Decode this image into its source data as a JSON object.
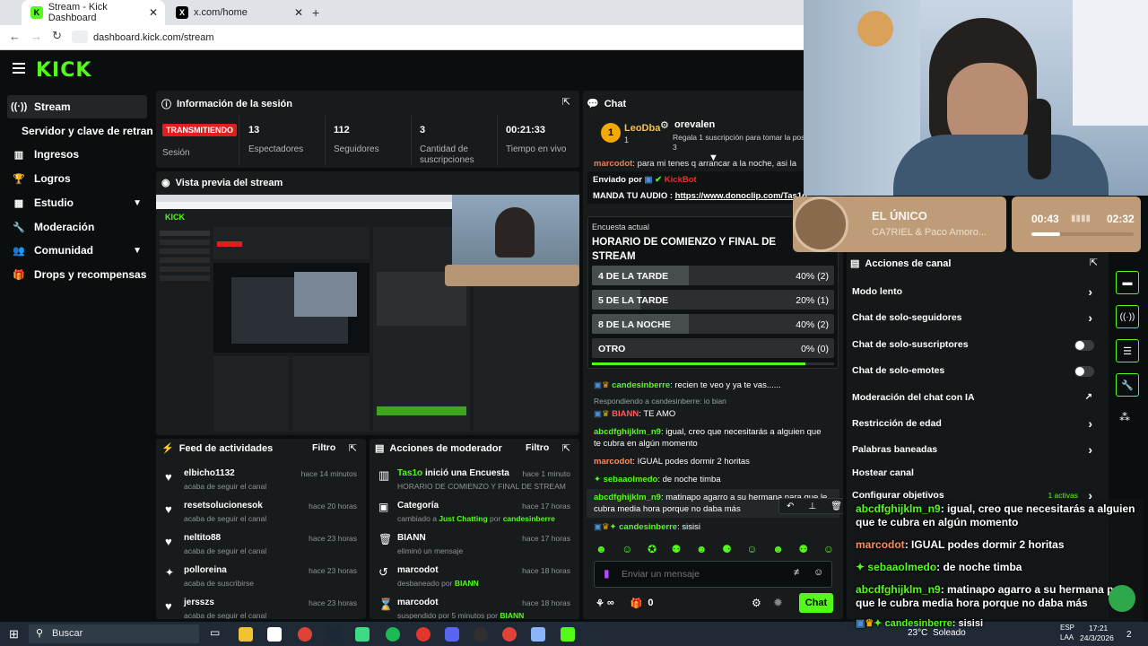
{
  "browser": {
    "tabs": [
      {
        "title": "Stream - Kick Dashboard",
        "active": true
      },
      {
        "title": "x.com/home",
        "active": false
      }
    ],
    "url": "dashboard.kick.com/stream"
  },
  "sidebar": {
    "items": [
      {
        "label": "Stream",
        "icon": "live-icon",
        "active": true
      },
      {
        "label": "Servidor y clave de retransm",
        "icon": "",
        "active": false
      },
      {
        "label": "Ingresos",
        "icon": "chart-icon",
        "active": false
      },
      {
        "label": "Logros",
        "icon": "trophy-icon",
        "active": false
      },
      {
        "label": "Estudio",
        "icon": "grid-icon",
        "active": false,
        "expandable": true
      },
      {
        "label": "Moderación",
        "icon": "wrench-icon",
        "active": false
      },
      {
        "label": "Comunidad",
        "icon": "people-icon",
        "active": false,
        "expandable": true
      },
      {
        "label": "Drops y recompensas",
        "icon": "gift-icon",
        "active": false
      }
    ]
  },
  "session": {
    "title": "Información de la sesión",
    "status": "TRANSMITIENDO",
    "session_label": "Sesión",
    "stats": [
      {
        "value": "13",
        "label": "Espectadores"
      },
      {
        "value": "112",
        "label": "Seguidores"
      },
      {
        "value": "3",
        "label": "Cantidad de suscripciones"
      },
      {
        "value": "00:21:33",
        "label": "Tiempo en vivo"
      }
    ]
  },
  "preview": {
    "title": "Vista previa del stream"
  },
  "activity": {
    "title": "Feed de actividades",
    "filter": "Filtro",
    "items": [
      {
        "name": "elbicho1132",
        "time": "hace 14 minutos",
        "desc": "acaba de seguir el canal",
        "icon": "heart-icon"
      },
      {
        "name": "resetsolucionesok",
        "time": "hace 20 horas",
        "desc": "acaba de seguir el canal",
        "icon": "heart-icon"
      },
      {
        "name": "neltito88",
        "time": "hace 23 horas",
        "desc": "acaba de seguir el canal",
        "icon": "heart-icon"
      },
      {
        "name": "polloreina",
        "time": "hace 23 horas",
        "desc": "acaba de suscribirse",
        "icon": "star-icon"
      },
      {
        "name": "jersszs",
        "time": "hace 23 horas",
        "desc": "acaba de seguir el canal",
        "icon": "heart-icon"
      }
    ]
  },
  "modactions": {
    "title": "Acciones de moderador",
    "filter": "Filtro",
    "items": [
      {
        "name": "Tas1o",
        "action": "inició una Encuesta",
        "time": "hace 1 minuto",
        "desc": "HORARIO DE COMIENZO Y FINAL DE STREAM",
        "icon": "poll-icon"
      },
      {
        "name": "Categoría",
        "action": "",
        "time": "hace 17 horas",
        "desc_pre": "cambiado a",
        "desc_hl": "Just Chatting",
        "desc_mid": "por",
        "desc_hl2": "candesinberre",
        "icon": "category-icon"
      },
      {
        "name": "BIANN",
        "action": "",
        "time": "hace 17 horas",
        "desc": "eliminó un mensaje",
        "icon": "trash-icon"
      },
      {
        "name": "marcodot",
        "action": "",
        "time": "hace 18 horas",
        "desc_pre": "desbaneado por",
        "desc_hl": "BIANN",
        "icon": "undo-icon"
      },
      {
        "name": "marcodot",
        "action": "",
        "time": "hace 18 horas",
        "desc_pre": "suspendido por 5 minutos por",
        "desc_hl": "BIANN",
        "icon": "hourglass-icon"
      }
    ]
  },
  "chat": {
    "title": "Chat",
    "pinned_users": [
      {
        "name": "LeoDba",
        "rank": "1"
      },
      {
        "name": "orevalen",
        "desc": "Regala 1 suscripción para tomar la pos",
        "extra": "3"
      }
    ],
    "partial_line": {
      "user": "marcodot",
      "text": "para mi tenes q arrancar a la noche, asi la"
    },
    "sent_by_label": "Enviado por",
    "sent_by_user": "KickBot",
    "sent_text": "MANDA TU AUDIO :",
    "sent_link": "https://www.donoclip.com/Tas1o",
    "poll": {
      "label": "Encuesta actual",
      "question": "HORARIO DE COMIENZO Y FINAL DE STREAM",
      "options": [
        {
          "label": "4 DE LA TARDE",
          "pct": "40% (2)",
          "fill": 0.4
        },
        {
          "label": "5 DE LA TARDE",
          "pct": "20% (1)",
          "fill": 0.2
        },
        {
          "label": "8 DE LA NOCHE",
          "pct": "40% (2)",
          "fill": 0.4
        },
        {
          "label": "OTRO",
          "pct": "0% (0)",
          "fill": 0
        }
      ],
      "progress": 0.88
    },
    "messages": [
      {
        "user": "candesinberre",
        "text": "recien te veo y ya te vas......",
        "color": "#53fc18"
      },
      {
        "reply": "Respondiendo a candesinberre: io bian"
      },
      {
        "user": "BIANN",
        "text": "TE AMO",
        "color": "#ff5b5b"
      },
      {
        "user": "abcdfghijklm_n9",
        "text": "igual, creo que necesitarás a alguien que te cubra en algún momento",
        "color": "#53fc18"
      },
      {
        "user": "marcodot",
        "text": "IGUAL podes dormir 2 horitas",
        "color": "#ff8c5a"
      },
      {
        "user": "sebaaolmedo",
        "text": "de noche timba",
        "color": "#53fc18"
      },
      {
        "user": "abcdfghijklm_n9",
        "text": "matinapo agarro a su hermana para que le cubra media hora porque no daba más",
        "color": "#53fc18"
      },
      {
        "user": "candesinberre",
        "text": "sisisi",
        "color": "#53fc18"
      }
    ],
    "input_placeholder": "Enviar un mensaje",
    "points": "∞",
    "gift_count": "0",
    "send_label": "Chat"
  },
  "channel_actions": {
    "title": "Acciones de canal",
    "items": [
      {
        "label": "Modo lento",
        "type": "arrow"
      },
      {
        "label": "Chat de solo-seguidores",
        "type": "arrow"
      },
      {
        "label": "Chat de solo-suscriptores",
        "type": "toggle"
      },
      {
        "label": "Chat de solo-emotes",
        "type": "toggle"
      },
      {
        "label": "Moderación del chat con IA",
        "type": "external"
      },
      {
        "label": "Restricción de edad",
        "type": "arrow"
      },
      {
        "label": "Palabras baneadas",
        "type": "arrow"
      },
      {
        "label": "Hostear canal",
        "type": "none"
      },
      {
        "label": "Configurar objetivos",
        "type": "arrow",
        "badge": "1 activas"
      }
    ]
  },
  "music_widget": {
    "title": "EL ÚNICO",
    "artist": "CA7RIEL & Paco Amoro...",
    "elapsed": "00:43",
    "total": "02:32",
    "progress": 0.28
  },
  "overlay_chat": [
    {
      "user": "abcdfghijklm_n9",
      "text": "igual, creo que necesitarás a alguien que te cubra en algún momento",
      "color": "#53fc18"
    },
    {
      "user": "marcodot",
      "text": "IGUAL podes dormir 2 horitas",
      "color": "#ff8c5a"
    },
    {
      "user": "sebaaolmedo",
      "text": "de noche timba",
      "color": "#53fc18"
    },
    {
      "user": "abcdfghijklm_n9",
      "text": "matinapo agarro a su hermana para que le cubra media hora porque no daba más",
      "color": "#53fc18"
    },
    {
      "user": "candesinberre",
      "text": "sisisi",
      "color": "#53fc18"
    }
  ],
  "taskbar": {
    "search": "Buscar",
    "weather": "23°C",
    "weather_desc": "Soleado",
    "lang1": "ESP",
    "lang2": "LAA",
    "time": "17:21",
    "date": "24/3/2026",
    "notif": "2"
  }
}
